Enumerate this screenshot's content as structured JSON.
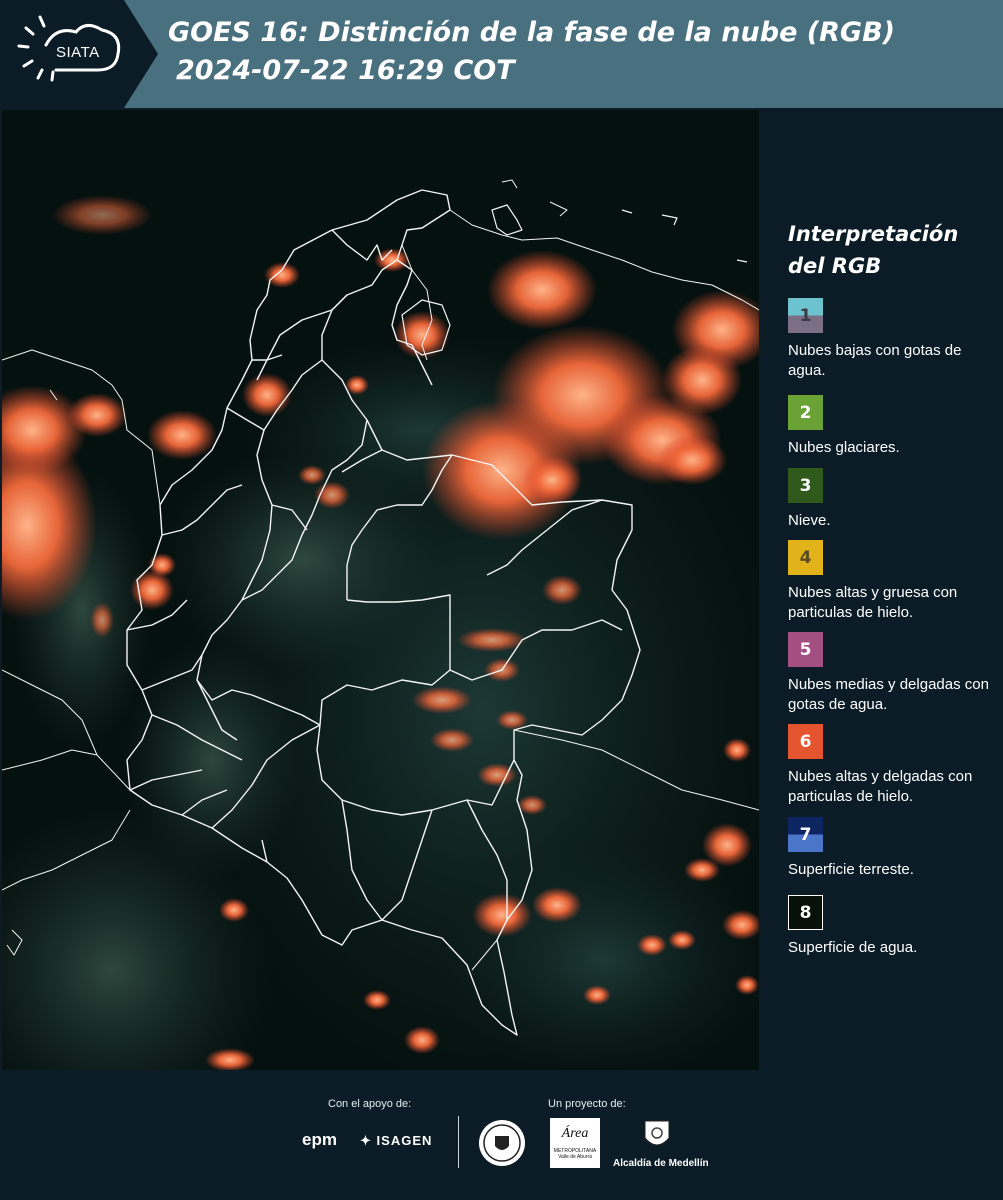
{
  "header": {
    "logo_text": "SIATA",
    "title_line1": "GOES 16: Distinción de la fase de la nube (RGB)",
    "title_line2": "2024-07-22 16:29 COT"
  },
  "legend": {
    "title": "Interpretación del RGB",
    "items": [
      {
        "number": "1",
        "label": "Nubes bajas con gotas de agua.",
        "color_top": "#6cc3cf",
        "color_bottom": "#7b6f86",
        "num_color": "#3a3a44"
      },
      {
        "number": "2",
        "label": "Nubes glaciares.",
        "color_top": "#6aa235",
        "color_bottom": "#6aa235",
        "num_color": "#ffffff"
      },
      {
        "number": "3",
        "label": "Nieve.",
        "color_top": "#2f5a1c",
        "color_bottom": "#2f5a1c",
        "num_color": "#ffffff"
      },
      {
        "number": "4",
        "label": "Nubes altas y gruesa con particulas de hielo.",
        "color_top": "#e2b21b",
        "color_bottom": "#e2b21b",
        "num_color": "#5a4a20"
      },
      {
        "number": "5",
        "label": "Nubes medias y delgadas con gotas de agua.",
        "color_top": "#a44f82",
        "color_bottom": "#a44f82",
        "num_color": "#ffffff"
      },
      {
        "number": "6",
        "label": "Nubes altas y delgadas con particulas de hielo.",
        "color_top": "#e4542e",
        "color_bottom": "#e4542e",
        "num_color": "#ffffff"
      },
      {
        "number": "7",
        "label": "Superficie terreste.",
        "color_top": "#0d2561",
        "color_bottom": "#4a75c9",
        "num_color": "#ffffff"
      },
      {
        "number": "8",
        "label": "Superficie de agua.",
        "color_top": "#071109",
        "color_bottom": "#071109",
        "num_color": "#ffffff"
      }
    ]
  },
  "footer": {
    "support_label": "Con el apoyo de:",
    "project_label": "Un proyecto de:",
    "epm": "epm",
    "isagen": "ISAGEN",
    "area_line1": "Área",
    "area_line2": "METROPOLITANA",
    "area_line3": "Valle de Aburrá",
    "alcaldia": "Alcaldía de Medellín"
  }
}
